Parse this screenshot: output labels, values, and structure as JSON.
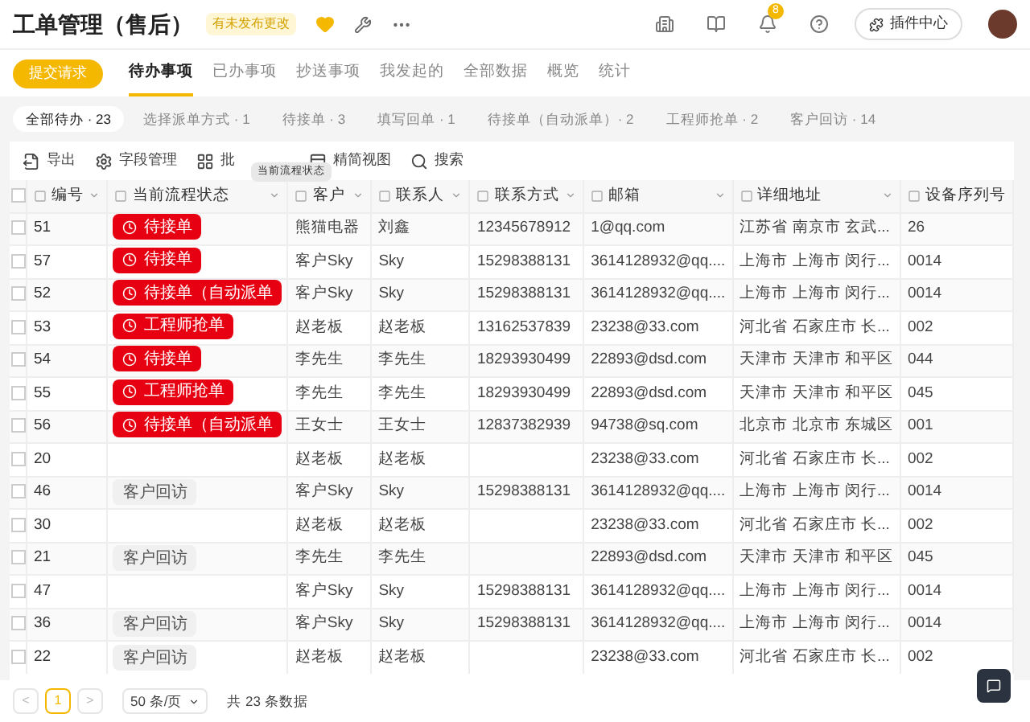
{
  "header": {
    "title": "工单管理（售后）",
    "badge": "有未发布更改",
    "notification_count": "8",
    "plugin_button": "插件中心"
  },
  "nav": {
    "submit_button": "提交请求",
    "tabs": [
      {
        "label": "待办事项",
        "selected": true
      },
      {
        "label": "已办事项",
        "selected": false
      },
      {
        "label": "抄送事项",
        "selected": false
      },
      {
        "label": "我发起的",
        "selected": false
      },
      {
        "label": "全部数据",
        "selected": false
      },
      {
        "label": "概览",
        "selected": false
      },
      {
        "label": "统计",
        "selected": false
      }
    ]
  },
  "filters": [
    {
      "label": "全部待办 · 23",
      "selected": true
    },
    {
      "label": "选择派单方式 · 1",
      "selected": false
    },
    {
      "label": "待接单 · 3",
      "selected": false
    },
    {
      "label": "填写回单 · 1",
      "selected": false
    },
    {
      "label": "待接单（自动派单）· 2",
      "selected": false
    },
    {
      "label": "工程师抢单 · 2",
      "selected": false
    },
    {
      "label": "客户回访 · 14",
      "selected": false
    }
  ],
  "toolbar": [
    {
      "kind": "export",
      "label": "导出"
    },
    {
      "kind": "fields",
      "label": "字段管理"
    },
    {
      "kind": "batch",
      "label": "批"
    },
    {
      "kind": "view",
      "label": "精简视图"
    },
    {
      "kind": "search",
      "label": "搜索"
    }
  ],
  "tooltip": "当前流程状态",
  "table": {
    "select_all_checked": false,
    "columns": [
      "编号",
      "当前流程状态",
      "客户",
      "联系人",
      "联系方式",
      "邮箱",
      "详细地址",
      "设备序列号"
    ],
    "rows": [
      {
        "checked": false,
        "id": "51",
        "status": {
          "kind": "alert",
          "label": "待接单"
        },
        "customer": "熊猫电器",
        "contact": "刘鑫",
        "phone": "12345678912",
        "email": "1@qq.com",
        "address": "江苏省 南京市 玄武...",
        "serial": "26"
      },
      {
        "checked": false,
        "id": "57",
        "status": {
          "kind": "alert",
          "label": "待接单"
        },
        "customer": "客户Sky",
        "contact": "Sky",
        "phone": "15298388131",
        "email": "3614128932@qq....",
        "address": "上海市 上海市 闵行...",
        "serial": "0014"
      },
      {
        "checked": false,
        "id": "52",
        "status": {
          "kind": "alert",
          "label": "待接单（自动派单"
        },
        "customer": "客户Sky",
        "contact": "Sky",
        "phone": "15298388131",
        "email": "3614128932@qq....",
        "address": "上海市 上海市 闵行...",
        "serial": "0014"
      },
      {
        "checked": false,
        "id": "53",
        "status": {
          "kind": "alert",
          "label": "工程师抢单"
        },
        "customer": "赵老板",
        "contact": "赵老板",
        "phone": "13162537839",
        "email": "23238@33.com",
        "address": "河北省 石家庄市 长...",
        "serial": "002"
      },
      {
        "checked": false,
        "id": "54",
        "status": {
          "kind": "alert",
          "label": "待接单"
        },
        "customer": "李先生",
        "contact": "李先生",
        "phone": "18293930499",
        "email": "22893@dsd.com",
        "address": "天津市 天津市 和平区",
        "serial": "044"
      },
      {
        "checked": false,
        "id": "55",
        "status": {
          "kind": "alert",
          "label": "工程师抢单"
        },
        "customer": "李先生",
        "contact": "李先生",
        "phone": "18293930499",
        "email": "22893@dsd.com",
        "address": "天津市 天津市 和平区",
        "serial": "045"
      },
      {
        "checked": false,
        "id": "56",
        "status": {
          "kind": "alert",
          "label": "待接单（自动派单"
        },
        "customer": "王女士",
        "contact": "王女士",
        "phone": "12837382939",
        "email": "94738@sq.com",
        "address": "北京市 北京市 东城区",
        "serial": "001"
      },
      {
        "checked": false,
        "id": "20",
        "customer": "赵老板",
        "contact": "赵老板",
        "email": "23238@33.com",
        "address": "河北省 石家庄市 长...",
        "serial": "002"
      },
      {
        "checked": false,
        "id": "46",
        "status": {
          "kind": "plain",
          "label": "客户回访"
        },
        "customer": "客户Sky",
        "contact": "Sky",
        "phone": "15298388131",
        "email": "3614128932@qq....",
        "address": "上海市 上海市 闵行...",
        "serial": "0014"
      },
      {
        "checked": false,
        "id": "30",
        "customer": "赵老板",
        "contact": "赵老板",
        "email": "23238@33.com",
        "address": "河北省 石家庄市 长...",
        "serial": "002"
      },
      {
        "checked": false,
        "id": "21",
        "status": {
          "kind": "plain",
          "label": "客户回访"
        },
        "customer": "李先生",
        "contact": "李先生",
        "email": "22893@dsd.com",
        "address": "天津市 天津市 和平区",
        "serial": "045"
      },
      {
        "checked": false,
        "id": "47",
        "customer": "客户Sky",
        "contact": "Sky",
        "phone": "15298388131",
        "email": "3614128932@qq....",
        "address": "上海市 上海市 闵行...",
        "serial": "0014"
      },
      {
        "checked": false,
        "id": "36",
        "status": {
          "kind": "plain",
          "label": "客户回访"
        },
        "customer": "客户Sky",
        "contact": "Sky",
        "phone": "15298388131",
        "email": "3614128932@qq....",
        "address": "上海市 上海市 闵行...",
        "serial": "0014"
      },
      {
        "checked": false,
        "id": "22",
        "status": {
          "kind": "plain",
          "label": "客户回访"
        },
        "customer": "赵老板",
        "contact": "赵老板",
        "email": "23238@33.com",
        "address": "河北省 石家庄市 长...",
        "serial": "002"
      }
    ]
  },
  "pagination": {
    "prev": "<",
    "pages": [
      {
        "label": "1",
        "selected": true
      }
    ],
    "next": ">",
    "page_size": "50 条/页",
    "total": "共 23 条数据"
  }
}
